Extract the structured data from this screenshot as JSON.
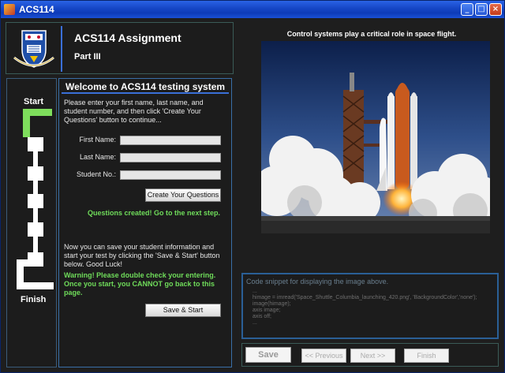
{
  "window": {
    "title": "ACS114"
  },
  "header": {
    "title": "ACS114 Assignment",
    "part": "Part III"
  },
  "progress": {
    "start_label": "Start",
    "finish_label": "Finish"
  },
  "form": {
    "heading": "Welcome to ACS114 testing system",
    "instructions": "Please enter your first name, last name, and student number, and then click 'Create Your Questions' button to continue...",
    "first_name_label": "First Name:",
    "first_name_value": "",
    "last_name_label": "Last Name:",
    "last_name_value": "",
    "student_no_label": "Student No.:",
    "student_no_value": "",
    "create_button": "Create Your Questions",
    "created_message": "Questions created! Go to the next step.",
    "save_instructions": "Now you can save your student information and start your test by clicking the 'Save & Start' button below.  Good Luck!",
    "warning": "Warning! Please double check your entering. Once you start, you CANNOT go back to this page.",
    "save_start_button": "Save & Start"
  },
  "image_panel": {
    "caption": "Control systems play a critical role in space flight."
  },
  "code_snippet": {
    "title": "Code snippet for displaying the image above.",
    "lines": [
      "...",
      "himage = imread('Space_Shuttle_Columbia_launching_420.png', 'BackgroundColor','none');",
      "image(himage);",
      "axis image;",
      "axis off;",
      "..."
    ]
  },
  "nav": {
    "save": "Save",
    "previous": "<< Previous",
    "next": "Next >>",
    "finish": "Finish"
  },
  "colors": {
    "accent": "#3a6fd8",
    "success": "#6fdc5a",
    "progress_done": "#7ede5c"
  }
}
